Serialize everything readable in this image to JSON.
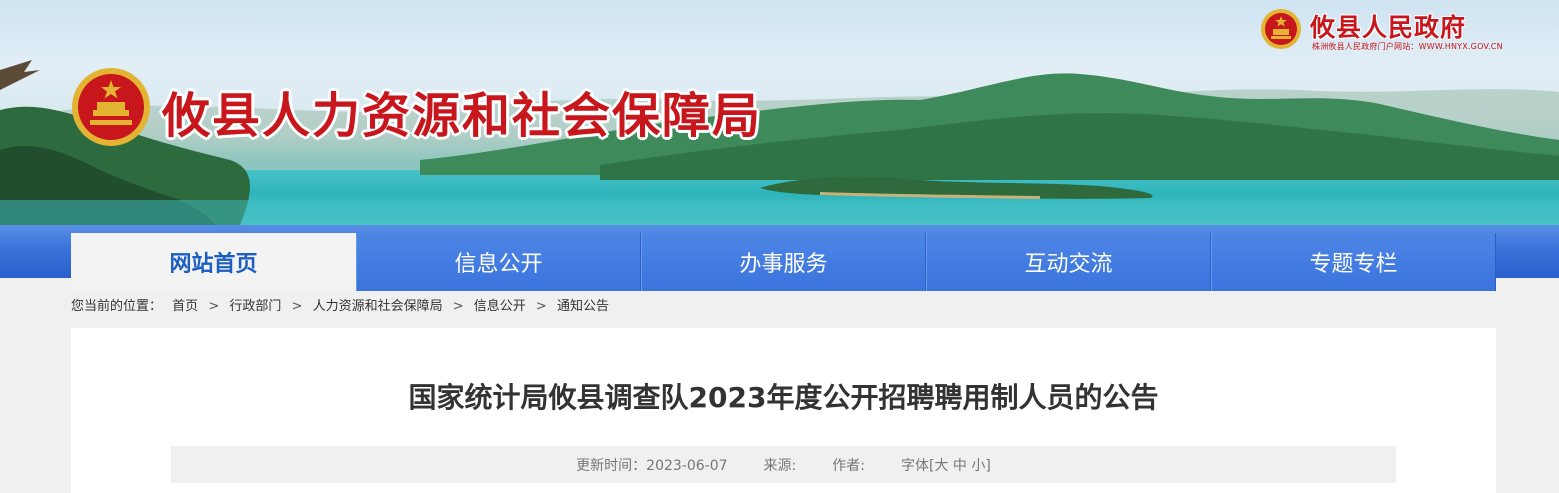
{
  "header": {
    "site_title": "攸县人力资源和社会保障局",
    "gov_badge": {
      "name": "攸县人民政府",
      "subtitle": "株洲攸县人民政府门户网站：WWW.HNYX.GOV.CN"
    },
    "colors": {
      "title_red": "#c8161d",
      "nav_blue": "#3a72da",
      "active_text": "#1d5fc0"
    }
  },
  "nav": {
    "items": [
      {
        "label": "网站首页",
        "active": true
      },
      {
        "label": "信息公开",
        "active": false
      },
      {
        "label": "办事服务",
        "active": false
      },
      {
        "label": "互动交流",
        "active": false
      },
      {
        "label": "专题专栏",
        "active": false
      }
    ]
  },
  "breadcrumb": {
    "prefix": "您当前的位置：",
    "items": [
      "首页",
      "行政部门",
      "人力资源和社会保障局",
      "信息公开",
      "通知公告"
    ],
    "separator": ">"
  },
  "article": {
    "title": "国家统计局攸县调查队2023年度公开招聘聘用制人员的公告",
    "meta": {
      "updated_label": "更新时间：",
      "updated_value": "2023-06-07",
      "source_label": "来源:",
      "author_label": "作者:",
      "font_label": "字体[",
      "font_large": "大",
      "font_medium": "中",
      "font_small": "小",
      "font_close": "]"
    }
  }
}
